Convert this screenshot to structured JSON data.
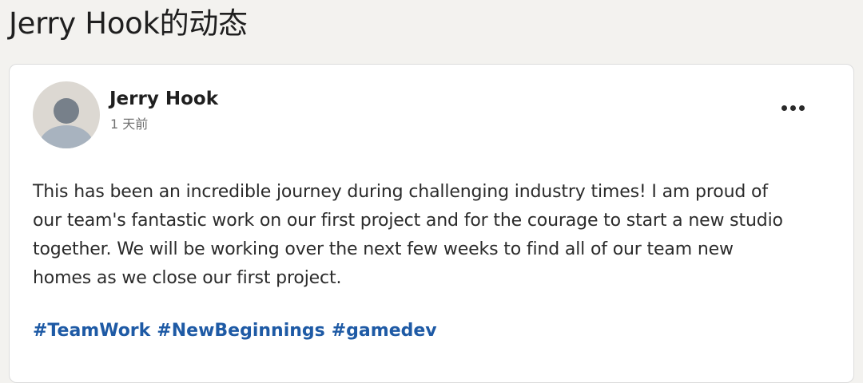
{
  "page": {
    "title": "Jerry Hook的动态"
  },
  "post": {
    "author_name": "Jerry Hook",
    "timestamp": "1 天前",
    "more_icon": "more-horizontal-icon",
    "body_lines": [
      "This has been an incredible journey during challenging industry times! I am proud of",
      "our team's fantastic work on our first project and for the courage to start a new studio",
      "together. We will be working over the next few weeks to find all of our team new",
      "homes as we close our first project."
    ],
    "hashtags": [
      "#TeamWork",
      "#NewBeginnings",
      "#gamedev"
    ]
  },
  "colors": {
    "hashtag": "#1e5aa5",
    "avatar_bg": "#dcd8d2"
  }
}
